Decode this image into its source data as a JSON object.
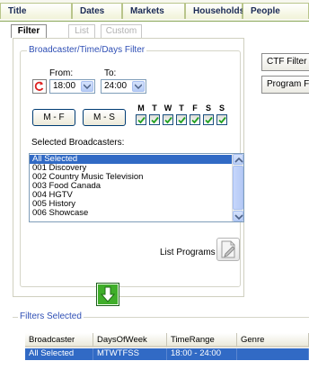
{
  "top_tabs": [
    "Title",
    "Dates",
    "Markets",
    "Households",
    "People"
  ],
  "sub_tabs": [
    "Filter",
    "List",
    "Custom"
  ],
  "filter_group": {
    "title": "Broadcaster/Time/Days Filter",
    "from_label": "From:",
    "to_label": "To:",
    "from_value": "18:00",
    "to_value": "24:00",
    "weekday_button": "M - F",
    "weekend_button": "M - S",
    "days": [
      {
        "letter": "M",
        "checked": true
      },
      {
        "letter": "T",
        "checked": true
      },
      {
        "letter": "W",
        "checked": true
      },
      {
        "letter": "T",
        "checked": true
      },
      {
        "letter": "F",
        "checked": true
      },
      {
        "letter": "S",
        "checked": true
      },
      {
        "letter": "S",
        "checked": true
      }
    ],
    "broadcasters_label": "Selected Broadcasters:",
    "broadcasters": [
      "All Selected",
      "001 Discovery",
      "002 Country Music Television",
      "003 Food Canada",
      "004 HGTV",
      "005 History",
      "006 Showcase"
    ],
    "selected_index": 0,
    "list_programs_label": "List Programs"
  },
  "side_buttons": [
    "CTF Filter",
    "Program F"
  ],
  "filters_selected": {
    "title": "Filters Selected",
    "columns": [
      "Broadcaster",
      "DaysOfWeek",
      "TimeRange",
      "Genre"
    ],
    "row": [
      "All Selected",
      "MTWTFSS",
      "18:00 - 24:00",
      ""
    ]
  },
  "colors": {
    "accent_blue": "#2f4fb5",
    "selection": "#316ac5",
    "check_green": "#21a121",
    "arrow_green": "#3fae2a"
  },
  "icons": {
    "reset": "reset-icon",
    "list_programs": "document-icon",
    "add_filter": "green-down-arrow-icon"
  }
}
